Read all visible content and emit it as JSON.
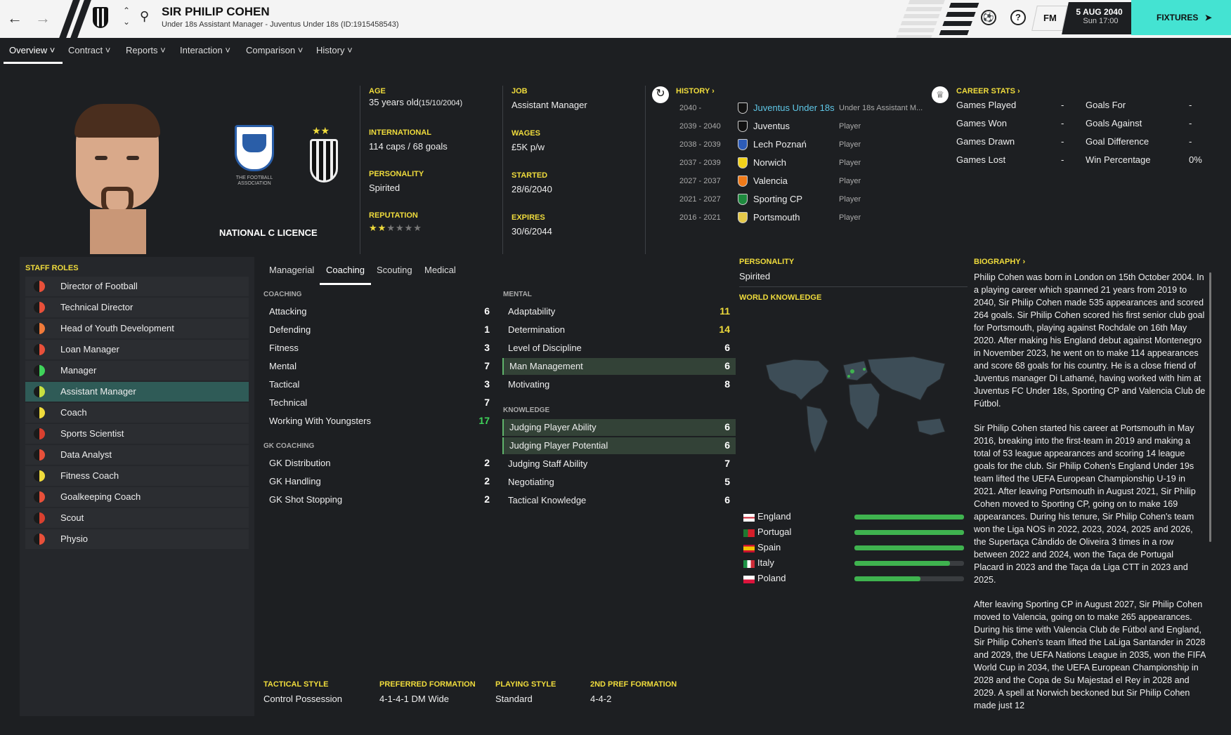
{
  "header": {
    "name": "SIR PHILIP COHEN",
    "subtitle": "Under 18s Assistant Manager - Juventus Under 18s (ID:1915458543)",
    "date": "5 AUG 2040",
    "day_time": "Sun 17:00",
    "fm_label": "FM",
    "help_label": "?",
    "fixtures_label": "FIXTURES",
    "accent_color": "#44e3d2"
  },
  "nav": {
    "items": [
      "Overview",
      "Contract",
      "Reports",
      "Interaction",
      "Comparison",
      "History"
    ],
    "active": "Overview"
  },
  "profile": {
    "licence": "NATIONAL C LICENCE",
    "age_label": "AGE",
    "age_value": "35 years old",
    "dob": "(15/10/2004)",
    "international_label": "INTERNATIONAL",
    "international_value": "114 caps / 68 goals",
    "personality_label": "PERSONALITY",
    "personality_value": "Spirited",
    "reputation_label": "REPUTATION",
    "reputation_stars": 1.5,
    "reputation_max": 6,
    "job_label": "JOB",
    "job_value": "Assistant Manager",
    "wages_label": "WAGES",
    "wages_value": "£5K p/w",
    "started_label": "STARTED",
    "started_value": "28/6/2040",
    "expires_label": "EXPIRES",
    "expires_value": "30/6/2044",
    "fa_text": "THE FOOTBALL ASSOCIATION"
  },
  "history": {
    "title": "HISTORY",
    "rows": [
      {
        "years": "2040 -",
        "club": "Juventus Under 18s",
        "role": "Under 18s Assistant M...",
        "color": "#111"
      },
      {
        "years": "2039 - 2040",
        "club": "Juventus",
        "role": "Player",
        "color": "#111"
      },
      {
        "years": "2038 - 2039",
        "club": "Lech Poznań",
        "role": "Player",
        "color": "#2d5cb8"
      },
      {
        "years": "2037 - 2039",
        "club": "Norwich",
        "role": "Player",
        "color": "#f2d21a"
      },
      {
        "years": "2027 - 2037",
        "club": "Valencia",
        "role": "Player",
        "color": "#f07a18"
      },
      {
        "years": "2021 - 2027",
        "club": "Sporting CP",
        "role": "Player",
        "color": "#1e8a3e"
      },
      {
        "years": "2016 - 2021",
        "club": "Portsmouth",
        "role": "Player",
        "color": "#e5c94a"
      }
    ]
  },
  "career_stats": {
    "title": "CAREER STATS",
    "left": [
      {
        "label": "Games Played",
        "value": "-"
      },
      {
        "label": "Games Won",
        "value": "-"
      },
      {
        "label": "Games Drawn",
        "value": "-"
      },
      {
        "label": "Games Lost",
        "value": "-"
      }
    ],
    "right": [
      {
        "label": "Goals For",
        "value": "-"
      },
      {
        "label": "Goals Against",
        "value": "-"
      },
      {
        "label": "Goal Difference",
        "value": "-"
      },
      {
        "label": "Win Percentage",
        "value": "0%"
      }
    ]
  },
  "staff_roles": {
    "title": "STAFF ROLES",
    "items": [
      {
        "label": "Director of Football",
        "color": "#e8503a"
      },
      {
        "label": "Technical Director",
        "color": "#e8503a"
      },
      {
        "label": "Head of Youth Development",
        "color": "#f07a3a"
      },
      {
        "label": "Loan Manager",
        "color": "#e8503a"
      },
      {
        "label": "Manager",
        "color": "#3fd35a"
      },
      {
        "label": "Assistant Manager",
        "color": "#c8e040"
      },
      {
        "label": "Coach",
        "color": "#f0dc3c"
      },
      {
        "label": "Sports Scientist",
        "color": "#d9402f"
      },
      {
        "label": "Data Analyst",
        "color": "#e8503a"
      },
      {
        "label": "Fitness Coach",
        "color": "#f0dc3c"
      },
      {
        "label": "Goalkeeping Coach",
        "color": "#e8503a"
      },
      {
        "label": "Scout",
        "color": "#d9402f"
      },
      {
        "label": "Physio",
        "color": "#e8503a"
      }
    ],
    "selected": "Assistant Manager"
  },
  "attr_tabs": [
    "Managerial",
    "Coaching",
    "Scouting",
    "Medical"
  ],
  "attr_tab_active": "Coaching",
  "coaching": {
    "title": "COACHING",
    "items": [
      {
        "name": "Attacking",
        "value": "6"
      },
      {
        "name": "Defending",
        "value": "1"
      },
      {
        "name": "Fitness",
        "value": "3"
      },
      {
        "name": "Mental",
        "value": "7"
      },
      {
        "name": "Tactical",
        "value": "3"
      },
      {
        "name": "Technical",
        "value": "7"
      },
      {
        "name": "Working With Youngsters",
        "value": "17"
      }
    ]
  },
  "gk_coaching": {
    "title": "GK COACHING",
    "items": [
      {
        "name": "GK Distribution",
        "value": "2"
      },
      {
        "name": "GK Handling",
        "value": "2"
      },
      {
        "name": "GK Shot Stopping",
        "value": "2"
      }
    ]
  },
  "mental": {
    "title": "MENTAL",
    "items": [
      {
        "name": "Adaptability",
        "value": "11"
      },
      {
        "name": "Determination",
        "value": "14"
      },
      {
        "name": "Level of Discipline",
        "value": "6"
      },
      {
        "name": "Man Management",
        "value": "6"
      },
      {
        "name": "Motivating",
        "value": "8"
      }
    ]
  },
  "knowledge": {
    "title": "KNOWLEDGE",
    "items": [
      {
        "name": "Judging Player Ability",
        "value": "6"
      },
      {
        "name": "Judging Player Potential",
        "value": "6"
      },
      {
        "name": "Judging Staff Ability",
        "value": "7"
      },
      {
        "name": "Negotiating",
        "value": "5"
      },
      {
        "name": "Tactical Knowledge",
        "value": "6"
      }
    ]
  },
  "tactics": {
    "tactical_style_label": "TACTICAL STYLE",
    "tactical_style": "Control Possession",
    "preferred_formation_label": "PREFERRED FORMATION",
    "preferred_formation": "4-1-4-1 DM Wide",
    "playing_style_label": "PLAYING STYLE",
    "playing_style": "Standard",
    "second_formation_label": "2ND PREF FORMATION",
    "second_formation": "4-4-2"
  },
  "world": {
    "personality_label": "PERSONALITY",
    "personality_value": "Spirited",
    "knowledge_label": "WORLD KNOWLEDGE",
    "nations": [
      {
        "name": "England",
        "level": 1.0
      },
      {
        "name": "Portugal",
        "level": 1.0
      },
      {
        "name": "Spain",
        "level": 1.0
      },
      {
        "name": "Italy",
        "level": 0.87
      },
      {
        "name": "Poland",
        "level": 0.6
      }
    ]
  },
  "biography": {
    "title": "BIOGRAPHY",
    "paragraphs": [
      "Philip Cohen was born in London on 15th October 2004. In a playing career which spanned 21 years from 2019 to 2040, Sir Philip Cohen made 535 appearances and scored 264 goals. Sir Philip Cohen scored his first senior club goal for Portsmouth, playing against Rochdale on 16th May 2020. After making his England debut against Montenegro in November 2023, he went on to make 114 appearances and score 68 goals for his country. He is a close friend of Juventus manager Di Lathamé, having worked with him at Juventus FC Under 18s, Sporting CP and Valencia Club de Fútbol.",
      "Sir Philip Cohen started his career at Portsmouth in May 2016, breaking into the first-team in 2019 and making a total of 53 league appearances and scoring 14 league goals for the club. Sir Philip Cohen's England Under 19s team lifted the UEFA European Championship U-19 in 2021. After leaving Portsmouth in August 2021, Sir Philip Cohen moved to Sporting CP, going on to make 169 appearances. During his tenure, Sir Philip Cohen's team won the Liga NOS in 2022, 2023, 2024, 2025 and 2026, the Supertaça Cândido de Oliveira 3 times in a row between 2022 and 2024, won the Taça de Portugal Placard in 2023 and the Taça da Liga CTT in 2023 and 2025.",
      "After leaving Sporting CP in August 2027, Sir Philip Cohen moved to Valencia, going on to make 265 appearances. During his time with Valencia Club de Fútbol and England, Sir Philip Cohen's team lifted the LaLiga Santander in 2028 and 2029, the UEFA Nations League in 2035, won the FIFA World Cup in 2034, the UEFA European Championship in 2028 and the Copa de Su Majestad el Rey in 2028 and 2029. A spell at Norwich beckoned but Sir Philip Cohen made just 12"
    ]
  }
}
